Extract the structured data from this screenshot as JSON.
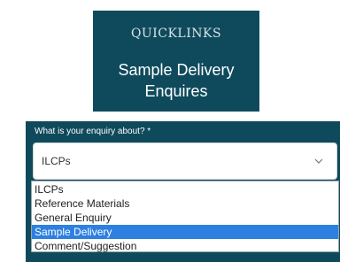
{
  "quicklinks": {
    "heading": "QUICKLINKS",
    "title_line1": "Sample Delivery",
    "title_line2": "Enquires"
  },
  "form": {
    "label": "What is your enquiry about? *",
    "select": {
      "value": "ILCPs"
    },
    "options": [
      "ILCPs",
      "Reference Materials",
      "General Enquiry",
      "Sample Delivery",
      "Comment/Suggestion"
    ],
    "highlighted_option": "Sample Delivery"
  },
  "colors": {
    "panel_background": "#0f4a5c",
    "highlight": "#2d7fe0"
  },
  "icons": {
    "select_arrow": "chevron-down-icon"
  }
}
